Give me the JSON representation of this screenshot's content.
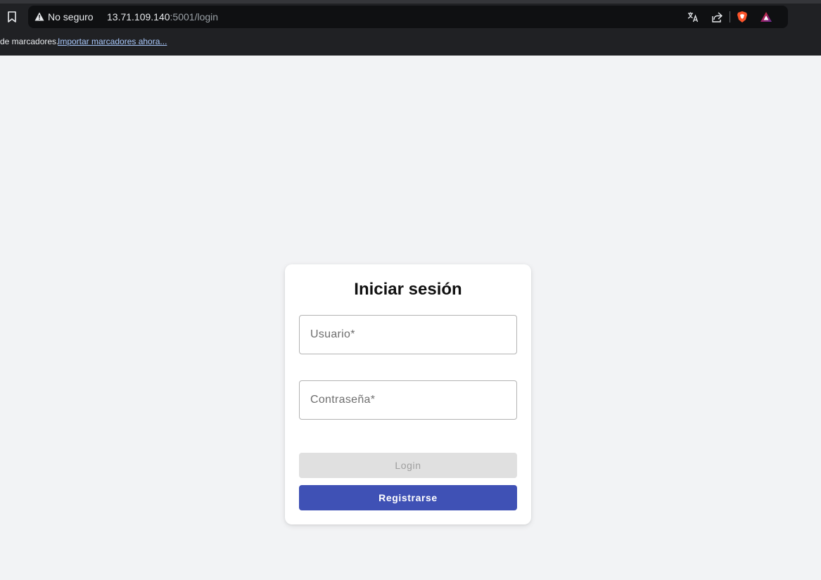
{
  "browser": {
    "security_label": "No seguro",
    "url_host": "13.71.109.140",
    "url_path": ":5001/login",
    "bookmarks_bar_text": "de marcadores.",
    "bookmarks_bar_link": "Importar marcadores ahora...",
    "icons": [
      "bookmark-icon",
      "warning-icon",
      "translate-icon",
      "share-icon",
      "brave-shields-icon",
      "brave-rewards-icon"
    ]
  },
  "login": {
    "title": "Iniciar sesión",
    "username_placeholder": "Usuario*",
    "password_placeholder": "Contraseña*",
    "login_label": "Login",
    "register_label": "Registrarse"
  },
  "colors": {
    "page_background": "#f2f3f5",
    "register_button": "#3f51b5",
    "login_button_disabled": "#e0e0e0"
  }
}
